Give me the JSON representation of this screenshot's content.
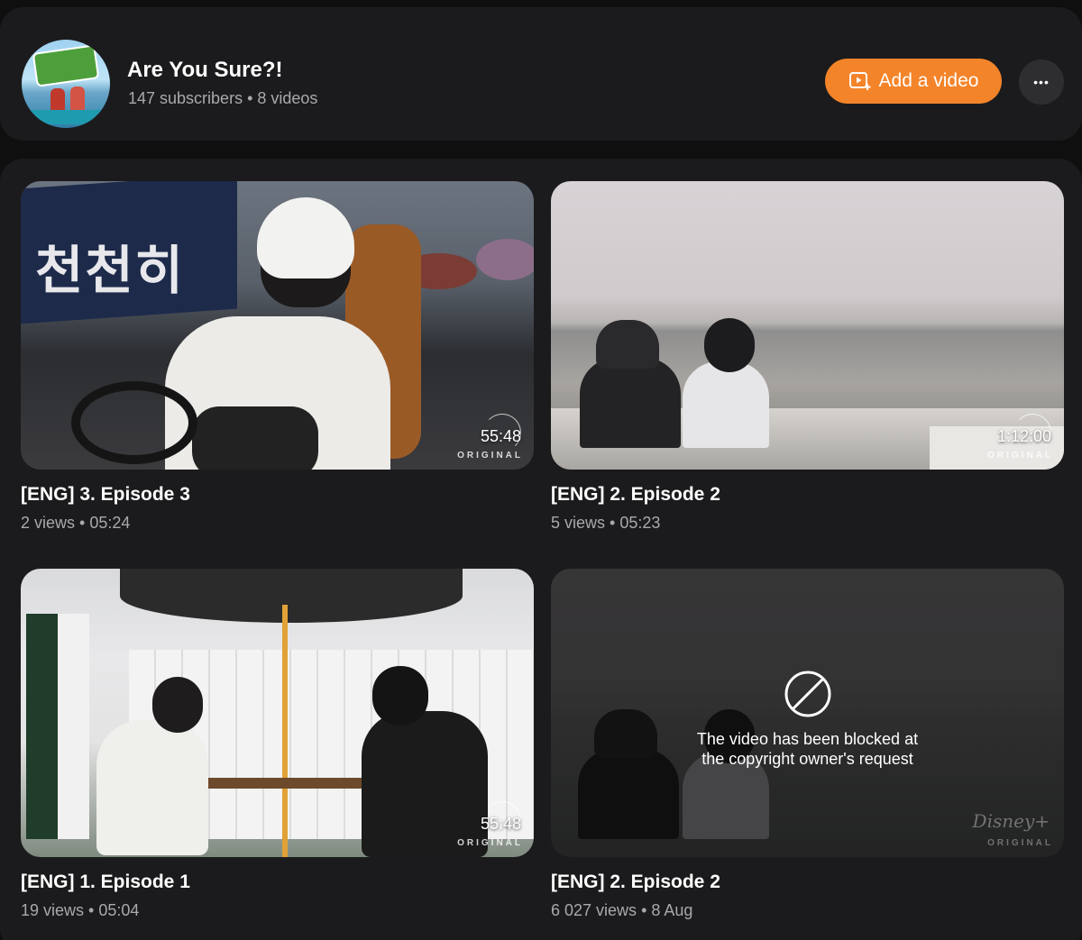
{
  "channel": {
    "name": "Are You Sure?!",
    "avatar_icon": "channel-avatar",
    "subscribers": "147 subscribers",
    "separator": "•",
    "videos_count": "8 videos"
  },
  "actions": {
    "add_video_label": "Add a video",
    "add_video_icon": "video-add-icon",
    "more_icon": "more-horizontal-icon",
    "more_label": "•••"
  },
  "colors": {
    "accent": "#f4842a",
    "background": "#0f0f10",
    "card": "#1b1b1d",
    "muted_text": "#a9a9ad"
  },
  "videos": [
    {
      "title": "[ENG] 3. Episode 3",
      "views": "2 views",
      "separator": "•",
      "date": "05:24",
      "duration": "55:48",
      "badge": "ORIGINAL",
      "blocked": false
    },
    {
      "title": "[ENG] 2. Episode 2",
      "views": "5 views",
      "separator": "•",
      "date": "05:23",
      "duration": "1:12:00",
      "badge": "ORIGINAL",
      "blocked": false
    },
    {
      "title": "[ENG] 1. Episode 1",
      "views": "19 views",
      "separator": "•",
      "date": "05:04",
      "duration": "55:48",
      "badge": "ORIGINAL",
      "blocked": false
    },
    {
      "title": "[ENG] 2. Episode 2",
      "views": "6 027 views",
      "separator": "•",
      "date": "8 Aug",
      "blocked": true,
      "blocked_icon": "blocked-icon",
      "blocked_message_line1": "The video has been blocked at",
      "blocked_message_line2": "the copyright owner's request",
      "watermark": "Disney+",
      "badge": "ORIGINAL"
    }
  ]
}
